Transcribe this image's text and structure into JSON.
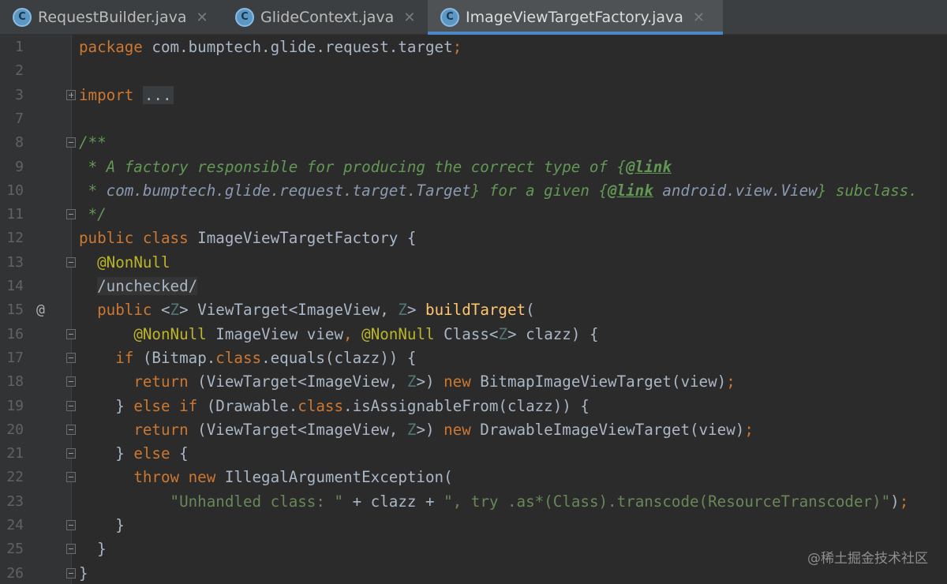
{
  "tabs": [
    {
      "label": "RequestBuilder.java",
      "icon": "C",
      "close": "✕"
    },
    {
      "label": "GlideContext.java",
      "icon": "C",
      "close": "✕"
    },
    {
      "label": "ImageViewTargetFactory.java",
      "icon": "C",
      "close": "✕"
    }
  ],
  "lines": [
    {
      "n": "1",
      "parts": [
        {
          "t": "package",
          "c": "kw"
        },
        {
          "t": " com.bumptech.glide.request.target",
          "c": ""
        },
        {
          "t": ";",
          "c": "kw"
        }
      ]
    },
    {
      "n": "2",
      "parts": []
    },
    {
      "n": "3",
      "parts": [
        {
          "t": "import",
          "c": "kw"
        },
        {
          "t": " ",
          "c": ""
        },
        {
          "t": "...",
          "c": "folded"
        }
      ]
    },
    {
      "n": "7",
      "parts": []
    },
    {
      "n": "8",
      "parts": [
        {
          "t": "/**",
          "c": "dc"
        }
      ]
    },
    {
      "n": "9",
      "parts": [
        {
          "t": " * A factory responsible for producing the correct type of {",
          "c": "dc"
        },
        {
          "t": "@link",
          "c": "dt"
        }
      ]
    },
    {
      "n": "10",
      "parts": [
        {
          "t": " * ",
          "c": "dc"
        },
        {
          "t": "com.bumptech.glide.request.target.Target",
          "c": "dr"
        },
        {
          "t": "} for a given {",
          "c": "dc"
        },
        {
          "t": "@link",
          "c": "dt"
        },
        {
          "t": " android.view.View",
          "c": "dr"
        },
        {
          "t": "} subclass.",
          "c": "dc"
        }
      ]
    },
    {
      "n": "11",
      "parts": [
        {
          "t": " */",
          "c": "dc"
        }
      ]
    },
    {
      "n": "12",
      "parts": [
        {
          "t": "public class",
          "c": "kw"
        },
        {
          "t": " ImageViewTargetFactory {",
          "c": ""
        }
      ]
    },
    {
      "n": "13",
      "parts": [
        {
          "t": "  ",
          "c": ""
        },
        {
          "t": "@NonNull",
          "c": "an"
        }
      ]
    },
    {
      "n": "14",
      "parts": [
        {
          "t": "  ",
          "c": ""
        },
        {
          "t": "/unchecked/",
          "c": "typing"
        }
      ]
    },
    {
      "n": "15",
      "parts": [
        {
          "t": "  ",
          "c": ""
        },
        {
          "t": "public",
          "c": "kw"
        },
        {
          "t": " <",
          "c": ""
        },
        {
          "t": "Z",
          "c": "tp"
        },
        {
          "t": "> ViewTarget<ImageView, ",
          "c": ""
        },
        {
          "t": "Z",
          "c": "tp"
        },
        {
          "t": "> ",
          "c": ""
        },
        {
          "t": "buildTarget",
          "c": "fn"
        },
        {
          "t": "(",
          "c": ""
        }
      ]
    },
    {
      "n": "16",
      "parts": [
        {
          "t": "      ",
          "c": ""
        },
        {
          "t": "@NonNull",
          "c": "an"
        },
        {
          "t": " ImageView view",
          "c": ""
        },
        {
          "t": ",",
          "c": "kw"
        },
        {
          "t": " ",
          "c": ""
        },
        {
          "t": "@NonNull",
          "c": "an"
        },
        {
          "t": " Class<",
          "c": ""
        },
        {
          "t": "Z",
          "c": "tp"
        },
        {
          "t": "> clazz) {",
          "c": ""
        }
      ]
    },
    {
      "n": "17",
      "parts": [
        {
          "t": "    ",
          "c": ""
        },
        {
          "t": "if",
          "c": "kw"
        },
        {
          "t": " (Bitmap.",
          "c": ""
        },
        {
          "t": "class",
          "c": "kw"
        },
        {
          "t": ".equals(clazz)) {",
          "c": ""
        }
      ]
    },
    {
      "n": "18",
      "parts": [
        {
          "t": "      ",
          "c": ""
        },
        {
          "t": "return",
          "c": "kw"
        },
        {
          "t": " (ViewTarget<ImageView, ",
          "c": ""
        },
        {
          "t": "Z",
          "c": "tp"
        },
        {
          "t": ">) ",
          "c": ""
        },
        {
          "t": "new",
          "c": "kw"
        },
        {
          "t": " BitmapImageViewTarget(view)",
          "c": ""
        },
        {
          "t": ";",
          "c": "kw"
        }
      ]
    },
    {
      "n": "19",
      "parts": [
        {
          "t": "    } ",
          "c": ""
        },
        {
          "t": "else if",
          "c": "kw"
        },
        {
          "t": " (Drawable.",
          "c": ""
        },
        {
          "t": "class",
          "c": "kw"
        },
        {
          "t": ".isAssignableFrom(clazz)) {",
          "c": ""
        }
      ]
    },
    {
      "n": "20",
      "parts": [
        {
          "t": "      ",
          "c": ""
        },
        {
          "t": "return",
          "c": "kw"
        },
        {
          "t": " (ViewTarget<ImageView, ",
          "c": ""
        },
        {
          "t": "Z",
          "c": "tp"
        },
        {
          "t": ">) ",
          "c": ""
        },
        {
          "t": "new",
          "c": "kw"
        },
        {
          "t": " DrawableImageViewTarget(view)",
          "c": ""
        },
        {
          "t": ";",
          "c": "kw"
        }
      ]
    },
    {
      "n": "21",
      "parts": [
        {
          "t": "    } ",
          "c": ""
        },
        {
          "t": "else",
          "c": "kw"
        },
        {
          "t": " {",
          "c": ""
        }
      ]
    },
    {
      "n": "22",
      "parts": [
        {
          "t": "      ",
          "c": ""
        },
        {
          "t": "throw new",
          "c": "kw"
        },
        {
          "t": " IllegalArgumentException(",
          "c": ""
        }
      ]
    },
    {
      "n": "23",
      "parts": [
        {
          "t": "          ",
          "c": ""
        },
        {
          "t": "\"Unhandled class: \"",
          "c": "str"
        },
        {
          "t": " + clazz + ",
          "c": ""
        },
        {
          "t": "\", try .as*(Class).transcode(ResourceTranscoder)\"",
          "c": "str"
        },
        {
          "t": ")",
          "c": ""
        },
        {
          "t": ";",
          "c": "kw"
        }
      ]
    },
    {
      "n": "24",
      "parts": [
        {
          "t": "    }",
          "c": ""
        }
      ]
    },
    {
      "n": "25",
      "parts": [
        {
          "t": "  }",
          "c": ""
        }
      ]
    },
    {
      "n": "26",
      "parts": [
        {
          "t": "}",
          "c": ""
        }
      ]
    }
  ],
  "gutter_markers": {
    "15": "@"
  },
  "watermark": "@稀土掘金技术社区",
  "colors": {
    "keyword": "#cc7832",
    "annotation": "#bbb529",
    "doc": "#629755",
    "string": "#6a8759",
    "method": "#ffc66d",
    "text": "#a9b7c6",
    "background": "#2b2b2b",
    "tab_accent": "#4a88c7"
  }
}
